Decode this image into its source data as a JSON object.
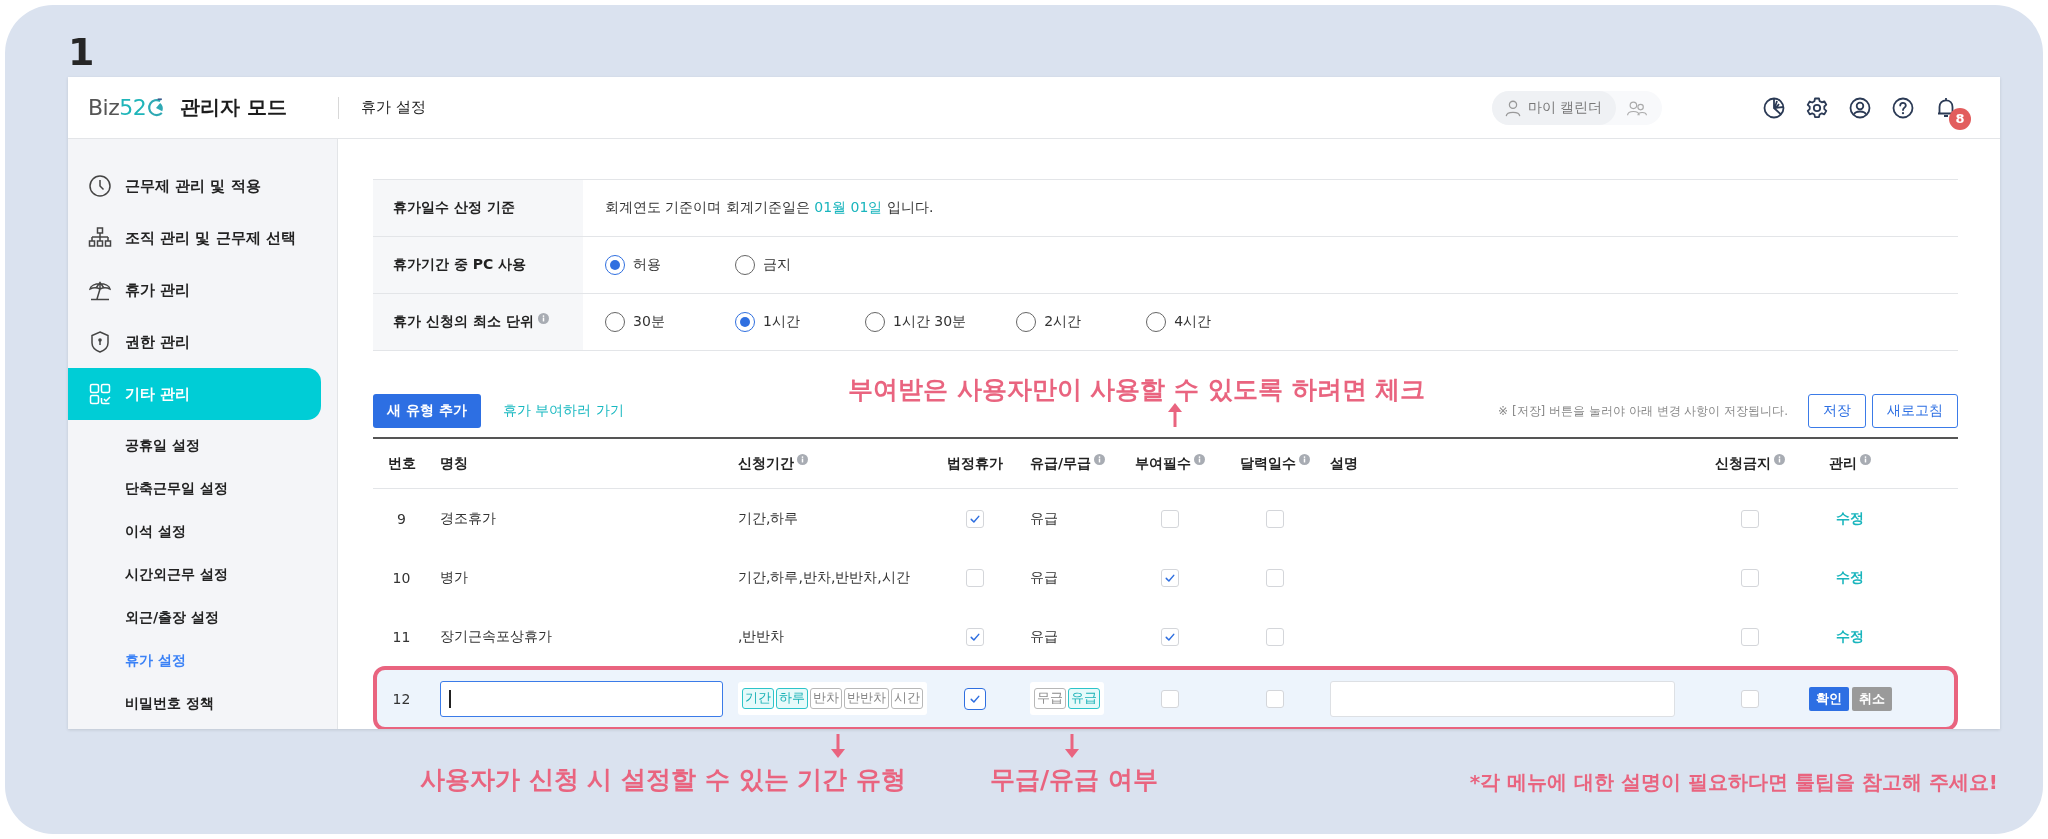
{
  "step_number": "1",
  "header": {
    "logo": "Biz**52**",
    "mode_title": "관리자 모드",
    "page_title": "휴가 설정",
    "calendar_button": "마이 캘린더",
    "notification_count": "8"
  },
  "sidebar": {
    "items": [
      {
        "label": "근무제 관리 및 적용",
        "selected": false
      },
      {
        "label": "조직 관리 및 근무제 선택",
        "selected": false
      },
      {
        "label": "휴가 관리",
        "selected": false
      },
      {
        "label": "권한 관리",
        "selected": false
      },
      {
        "label": "기타 관리",
        "selected": true,
        "children": [
          {
            "label": "공휴일 설정",
            "selected": false
          },
          {
            "label": "단축근무일 설정",
            "selected": false
          },
          {
            "label": "이석 설정",
            "selected": false
          },
          {
            "label": "시간외근무 설정",
            "selected": false
          },
          {
            "label": "외근/출장 설정",
            "selected": false
          },
          {
            "label": "휴가 설정",
            "selected": true
          },
          {
            "label": "비밀번호 정책",
            "selected": false
          }
        ]
      }
    ]
  },
  "settings": [
    {
      "kind": "text",
      "label": "휴가일수 산정 기준",
      "info": false,
      "text": "회계연도 기준이며 회계기준일은 **01월 01일** 입니다."
    },
    {
      "kind": "radio",
      "label": "휴가기간 중 PC 사용",
      "info": false,
      "options": [
        {
          "label": "허용",
          "selected": true
        },
        {
          "label": "금지",
          "selected": false
        }
      ]
    },
    {
      "kind": "radio",
      "label": "휴가 신청의 최소 단위",
      "info": true,
      "options": [
        {
          "label": "30분",
          "selected": false
        },
        {
          "label": "1시간",
          "selected": true
        },
        {
          "label": "1시간 30분",
          "selected": false
        },
        {
          "label": "2시간",
          "selected": false
        },
        {
          "label": "4시간",
          "selected": false
        }
      ]
    }
  ],
  "toolbar": {
    "add_button": "새 유형 추가",
    "grant_link": "휴가 부여하러 가기",
    "note": "※ [저장] 버튼을 눌러야 아래 변경 사항이 저장됩니다.",
    "save_button": "저장",
    "refresh_button": "새로고침"
  },
  "table": {
    "columns": [
      {
        "label": "번호",
        "info": false
      },
      {
        "label": "명칭",
        "info": false
      },
      {
        "label": "신청기간",
        "info": true
      },
      {
        "label": "법정휴가",
        "info": false
      },
      {
        "label": "유급/무급",
        "info": true
      },
      {
        "label": "부여필수",
        "info": true
      },
      {
        "label": "달력일수",
        "info": true
      },
      {
        "label": "설명",
        "info": false
      },
      {
        "label": "신청금지",
        "info": true
      },
      {
        "label": "관리",
        "info": true
      }
    ],
    "rows": [
      {
        "kind": "view",
        "number": "9",
        "name": "경조휴가",
        "periods": "기간,하루",
        "statutory": true,
        "paid": "유급",
        "grant_required": false,
        "calendar_days": false,
        "apply_blocked": false,
        "action": "수정"
      },
      {
        "kind": "view",
        "number": "10",
        "name": "병가",
        "periods": "기간,하루,반차,반반차,시간",
        "statutory": false,
        "paid": "유급",
        "grant_required": true,
        "calendar_days": false,
        "apply_blocked": false,
        "action": "수정"
      },
      {
        "kind": "view",
        "number": "11",
        "name": "장기근속포상휴가",
        "periods": ",반반차",
        "statutory": true,
        "paid": "유급",
        "grant_required": true,
        "calendar_days": false,
        "apply_blocked": false,
        "action": "수정"
      },
      {
        "kind": "edit",
        "number": "12",
        "period_options": [
          {
            "label": "기간",
            "selected": true
          },
          {
            "label": "하루",
            "selected": true
          },
          {
            "label": "반차",
            "selected": false
          },
          {
            "label": "반반차",
            "selected": false
          },
          {
            "label": "시간",
            "selected": false
          }
        ],
        "statutory": true,
        "pay_options": [
          {
            "label": "무급",
            "selected": false
          },
          {
            "label": "유급",
            "selected": true
          }
        ],
        "grant_required": false,
        "calendar_days": false,
        "apply_blocked": false,
        "confirm_button": "확인",
        "cancel_button": "취소"
      }
    ]
  },
  "annotations": [
    {
      "kind": "above",
      "text": "부여받은 사용자만이 사용할 수 있도록 하려면 체크"
    },
    {
      "kind": "below",
      "text": "사용자가 신청 시 설정할 수 있는 기간 유형"
    },
    {
      "kind": "below",
      "text": "무급/유급 여부"
    },
    {
      "kind": "note",
      "text": "*각 메뉴에 대한 설명이 필요하다면 툴팁을 참고해 주세요!"
    }
  ]
}
